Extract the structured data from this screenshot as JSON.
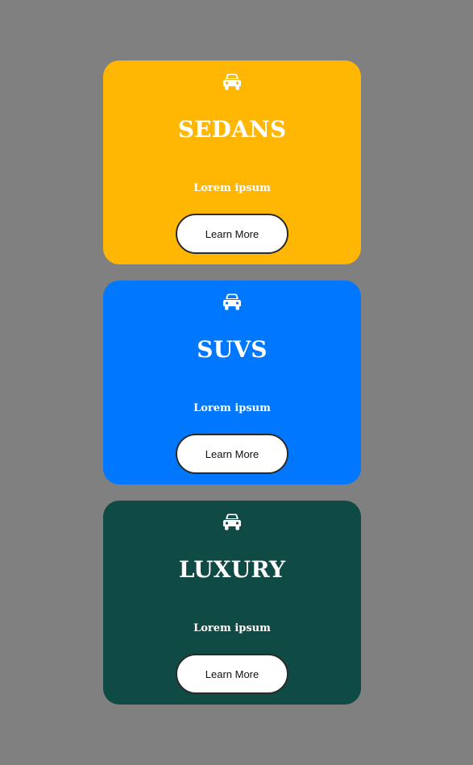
{
  "cards": [
    {
      "icon": "car-icon",
      "title": "SEDANS",
      "text": "Lorem ipsum",
      "button_label": "Learn More",
      "color": "#ffb703"
    },
    {
      "icon": "car-icon",
      "title": "SUVS",
      "text": "Lorem ipsum",
      "button_label": "Learn More",
      "color": "#0077ff"
    },
    {
      "icon": "car-icon",
      "title": "LUXURY",
      "text": "Lorem ipsum",
      "button_label": "Learn More",
      "color": "#0f4a44"
    }
  ],
  "colors": {
    "page_background": "#808080",
    "button_background": "#ffffff",
    "text": "#ffffff"
  }
}
